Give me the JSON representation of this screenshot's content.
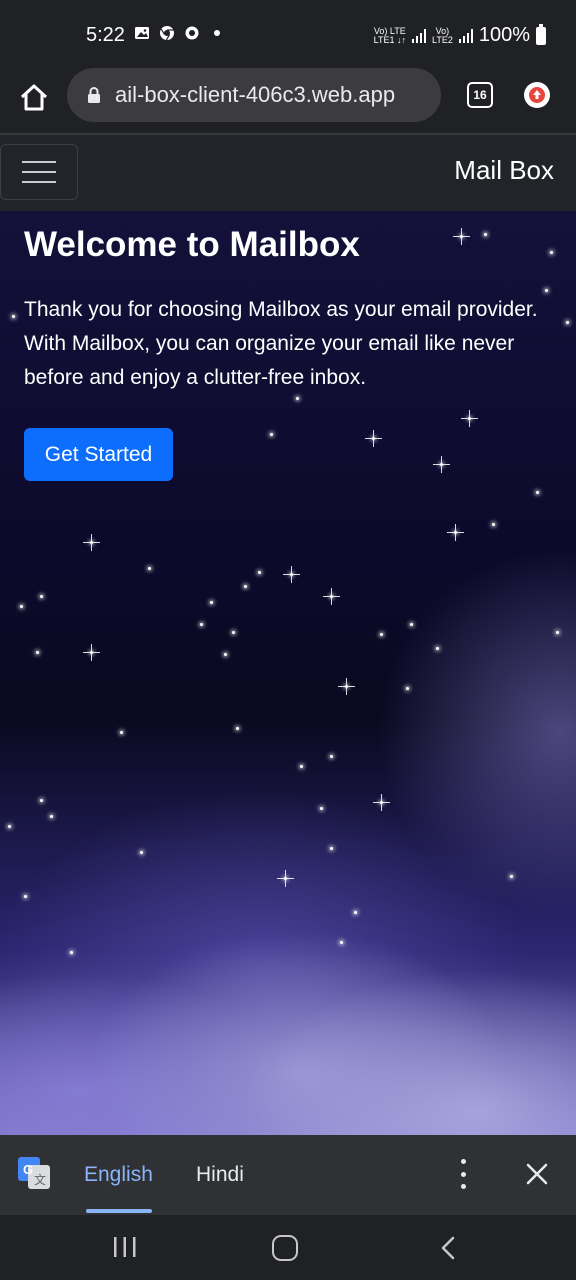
{
  "status_bar": {
    "time": "5:22",
    "icons": [
      "gallery-icon",
      "chrome-icon",
      "record-icon",
      "dot-icon"
    ],
    "sim1_label": "Vo) LTE\nLTE1",
    "sim2_label": "Vo)\nLTE2",
    "battery_percent": "100%"
  },
  "browser": {
    "url": "ail-box-client-406c3.web.app",
    "tab_count": "16"
  },
  "navbar": {
    "brand": "Mail Box"
  },
  "hero": {
    "title": "Welcome to Mailbox",
    "text": "Thank you for choosing Mailbox as your email provider. With Mailbox, you can organize your email like never before and enjoy a clutter-free inbox.",
    "cta_label": "Get Started"
  },
  "translate_bar": {
    "languages": [
      "English",
      "Hindi"
    ],
    "selected": "English"
  },
  "colors": {
    "primary_button": "#0d6efd",
    "navbar_bg": "#212529",
    "translate_accent": "#8ab4f8"
  }
}
